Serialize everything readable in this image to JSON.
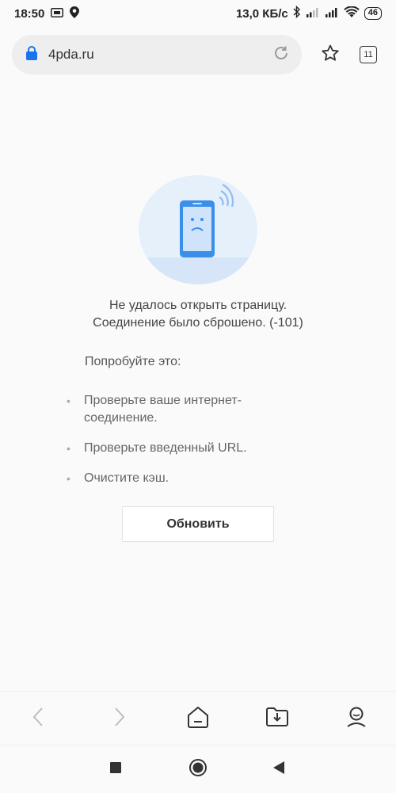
{
  "status_bar": {
    "time": "18:50",
    "network_speed": "13,0 КБ/с",
    "battery": "46",
    "icons": [
      "sim-icon",
      "location-icon",
      "bluetooth-icon",
      "signal-icon",
      "signal-icon",
      "wifi-icon"
    ]
  },
  "browser": {
    "url": "4pda.ru",
    "tab_count": "11",
    "icons": {
      "secure": "lock-icon",
      "reload": "reload-icon",
      "bookmark": "star-icon",
      "tabs": "tabs-icon"
    },
    "accent_color": "#1a73e8"
  },
  "error_page": {
    "title": "Не удалось открыть страницу.",
    "subtitle": "Соединение было сброшено. (-101)",
    "suggest_label": "Попробуйте это:",
    "tips": [
      "Проверьте ваше интернет-соединение.",
      "Проверьте введенный URL.",
      "Очистите кэш."
    ],
    "reload_button": "Обновить",
    "illustration_color": "#3b8eea"
  },
  "bottom_toolbar": {
    "icons": [
      "back-icon",
      "forward-icon",
      "home-icon",
      "downloads-icon",
      "profile-icon"
    ]
  },
  "nav_bar": {
    "icons": [
      "recent-apps-icon",
      "home-nav-icon",
      "back-nav-icon"
    ]
  }
}
